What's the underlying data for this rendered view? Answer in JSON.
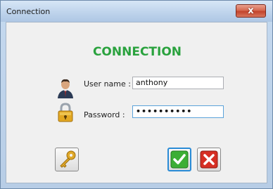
{
  "window": {
    "title": "Connection",
    "close_glyph": "x"
  },
  "form": {
    "heading": "CONNECTION",
    "username_label": "User name :",
    "username_value": "anthony",
    "password_label": "Password :",
    "password_value": "••••••••••"
  },
  "icons": {
    "avatar": "user-avatar-icon",
    "lock": "padlock-icon",
    "key": "key-icon",
    "ok": "checkmark-icon",
    "cancel": "cross-icon"
  },
  "colors": {
    "heading": "#2aa23e",
    "ok_green": "#3cae35",
    "cancel_red": "#d62f24",
    "key_gold": "#e0a92a"
  }
}
